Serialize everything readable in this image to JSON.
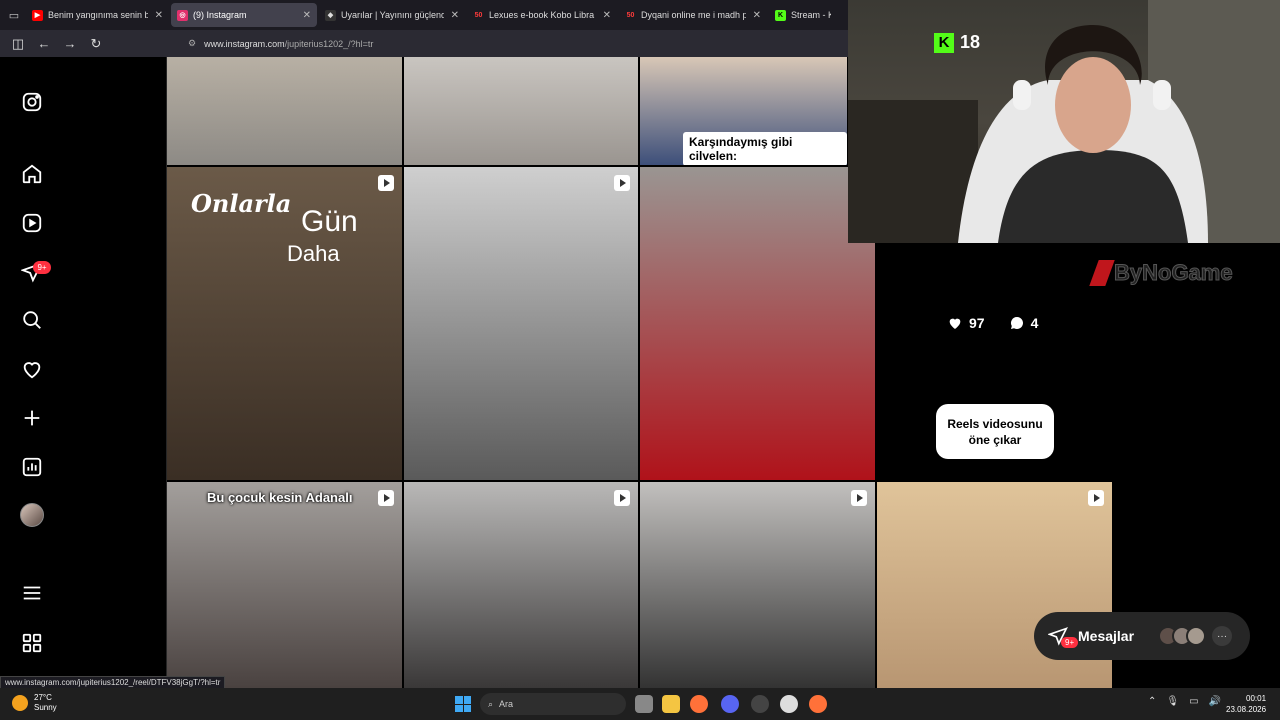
{
  "browser": {
    "tabs": [
      {
        "title": "Benim yangınıma senin bi gidişi",
        "icon": "youtube-icon",
        "color": "#ff0000",
        "active": false
      },
      {
        "title": "(9) Instagram",
        "icon": "instagram-icon",
        "color": "#e1306c",
        "active": true
      },
      {
        "title": "Uyarılar | Yayınını güçlendirmek",
        "icon": "streamlabs-icon",
        "color": "#dddddd",
        "active": false
      },
      {
        "title": "Lexues e-book Kobo Libra Color",
        "icon": "fifty-icon",
        "color": "#ff3b3b",
        "active": false
      },
      {
        "title": "Dyqani online me i madh per te",
        "icon": "fifty-icon",
        "color": "#ff3b3b",
        "active": false
      },
      {
        "title": "Stream - Kick",
        "icon": "kick-icon",
        "color": "#53fc18",
        "active": false
      }
    ],
    "url_prefix": "www.instagram.com",
    "url_path": "/jupiterius1202_/?hl=tr",
    "status_url": "www.instagram.com/jupiterius1202_/reel/DTFV38jGgT/?hl=tr"
  },
  "sidebar": {
    "notification_badge": "9+"
  },
  "grid": {
    "caption_1": "Karşındaymış gibi cilvelen:",
    "overlay_onlarla": "Onlarla",
    "overlay_gun": "Gün",
    "overlay_daha": "Daha",
    "caption_2": "Bu çocuk kesin Adanalı",
    "likes": "97",
    "comments": "4",
    "promote_label": "Reels videosunu öne çıkar"
  },
  "stream": {
    "viewers": "18",
    "sponsor": "ByNoGame"
  },
  "messages": {
    "label": "Mesajlar",
    "badge": "9+"
  },
  "taskbar": {
    "temperature": "27°C",
    "weather": "Sunny",
    "search_placeholder": "Ara",
    "time": "00:01",
    "date": "23.08.2026"
  }
}
